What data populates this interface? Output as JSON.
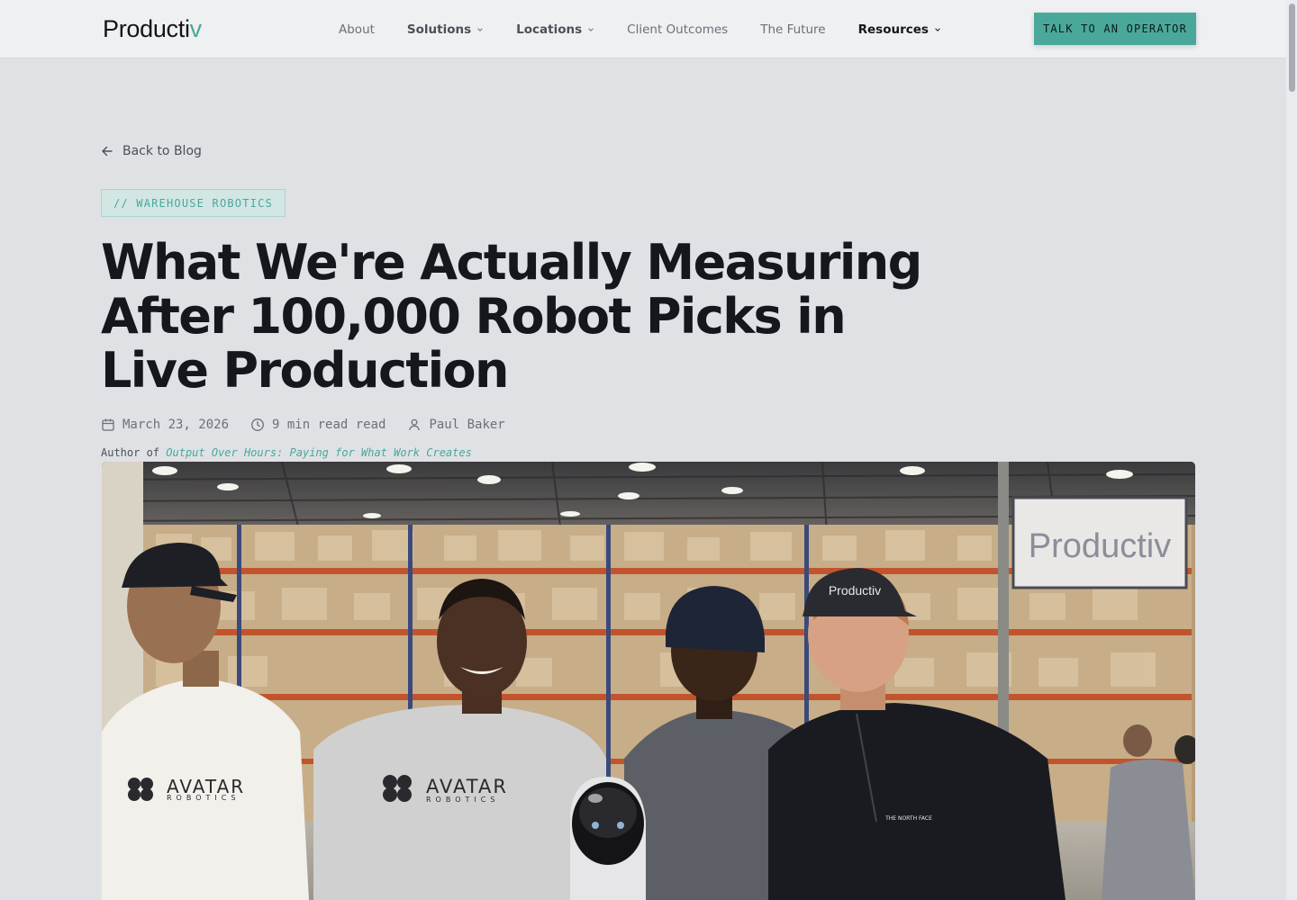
{
  "header": {
    "logo_main": "Producti",
    "logo_accent": "v",
    "nav": [
      {
        "label": "About"
      },
      {
        "label": "Solutions"
      },
      {
        "label": "Locations"
      },
      {
        "label": "Client Outcomes"
      },
      {
        "label": "The Future"
      },
      {
        "label": "Resources"
      }
    ],
    "cta_label": "TALK TO AN OPERATOR"
  },
  "article": {
    "back_label": "Back to Blog",
    "tag": "// WAREHOUSE ROBOTICS",
    "title": "What We're Actually Measuring After 100,000 Robot Picks in Live Production",
    "date": "March 23, 2026",
    "read_time": "9 min read read",
    "author": "Paul Baker",
    "author_of_prefix": "Author of",
    "author_book": "Output Over Hours: Paying for What Work Creates"
  },
  "hero": {
    "sign_text": "Productiv",
    "shirt_brand": "AVATAR",
    "shirt_sub": "ROBOTICS",
    "cap_text": "Productiv",
    "jacket_brand": "THE NORTH FACE"
  },
  "colors": {
    "accent": "#4aa89b",
    "background": "#dfe1e5",
    "header_bg": "#eef0f2",
    "text_dark": "#14171c",
    "text_muted": "#6b7079"
  }
}
